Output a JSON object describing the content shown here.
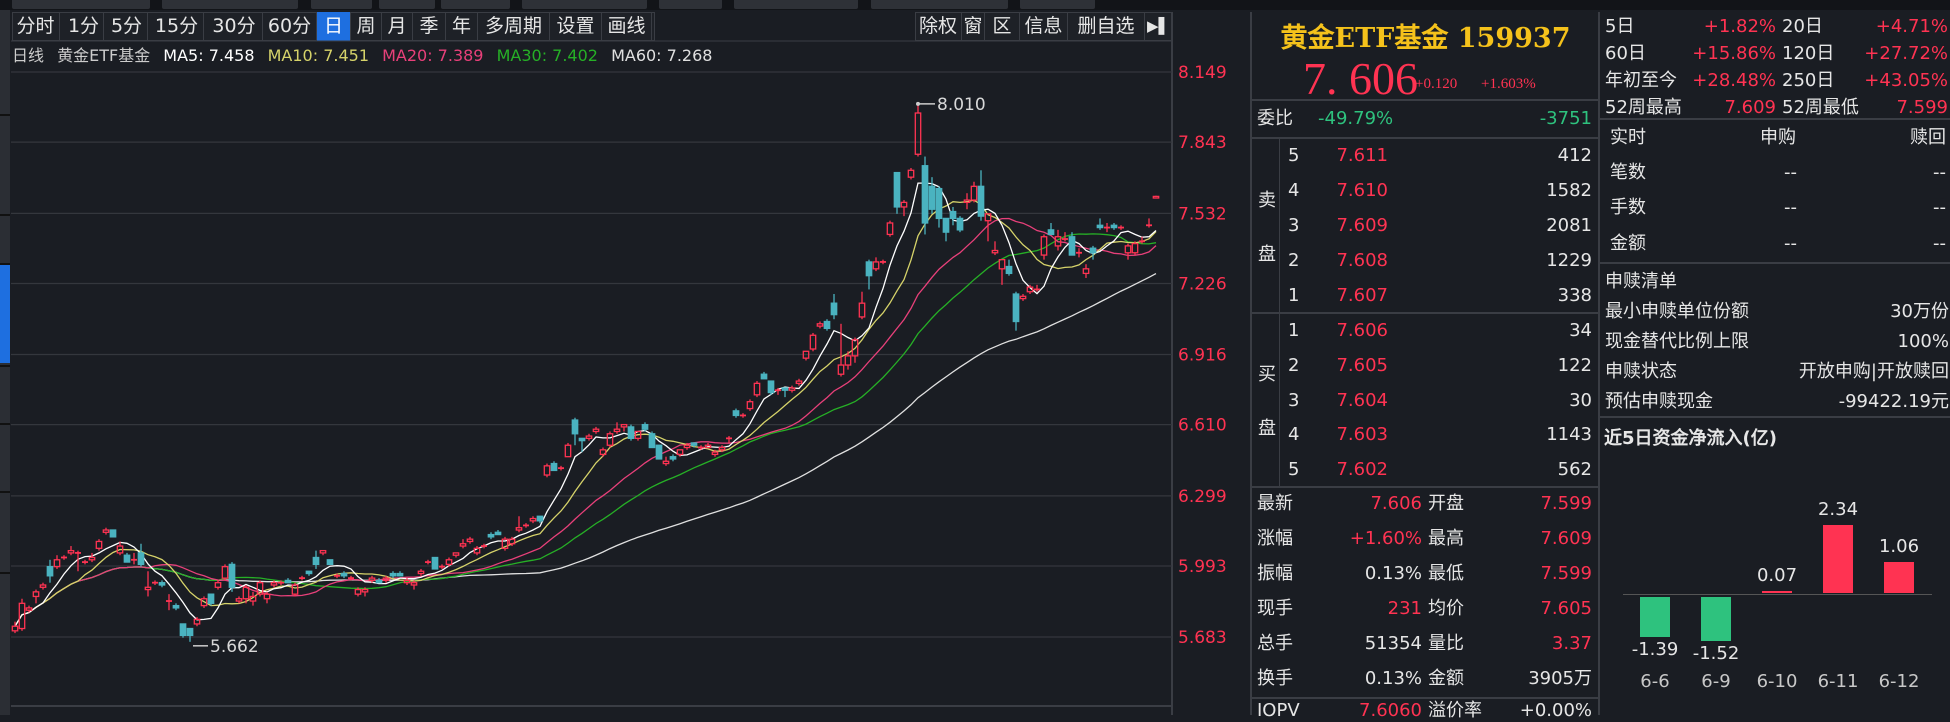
{
  "toolbar": {
    "tabs": [
      "分时",
      "1分",
      "5分",
      "15分",
      "30分",
      "60分",
      "日",
      "周",
      "月",
      "季",
      "年",
      "多周期",
      "设置",
      "画线"
    ],
    "active_tab": "日",
    "right_buttons": [
      "除权",
      "窗",
      "区",
      "信息",
      "删自选"
    ],
    "collapse_icon": "arrow-right-bar-icon"
  },
  "legend": {
    "period": "日线",
    "name": "黄金ETF基金",
    "ma5": "MA5: 7.458",
    "ma10": "MA10: 7.451",
    "ma20": "MA20: 7.389",
    "ma30": "MA30: 7.402",
    "ma60": "MA60: 7.268"
  },
  "colors": {
    "up": "#ff3352",
    "down": "#4ab3c0",
    "ma5": "#ffffff",
    "ma10": "#d6d36a",
    "ma20": "#e8407a",
    "ma30": "#26b026",
    "ma60": "#e0e0e0",
    "accent": "#1e6fe0",
    "title": "#f5c21b",
    "green": "#2ec27e"
  },
  "chart_data": {
    "type": "candlestick",
    "y_ticks": [
      "8.149",
      "7.843",
      "7.532",
      "7.226",
      "6.916",
      "6.610",
      "6.299",
      "5.993",
      "5.683"
    ],
    "ylim": [
      5.683,
      8.149
    ],
    "annotations": {
      "high": "8.010",
      "low": "5.662"
    },
    "ma_periods": [
      5,
      10,
      20,
      30,
      60
    ],
    "candles": [
      [
        5.71,
        5.75,
        5.7,
        5.73
      ],
      [
        5.72,
        5.85,
        5.71,
        5.83
      ],
      [
        5.8,
        5.82,
        5.79,
        5.81
      ],
      [
        5.86,
        5.89,
        5.83,
        5.88
      ],
      [
        5.9,
        5.92,
        5.89,
        5.91
      ],
      [
        5.99,
        6.02,
        5.92,
        5.95
      ],
      [
        5.99,
        6.04,
        5.98,
        6.02
      ],
      [
        6.03,
        6.04,
        6.02,
        6.03
      ],
      [
        6.05,
        6.08,
        6.04,
        6.06
      ],
      [
        6.05,
        6.06,
        5.97,
        6.05
      ],
      [
        6.01,
        6.02,
        6.0,
        6.01
      ],
      [
        6.02,
        6.05,
        6.01,
        6.03
      ],
      [
        6.07,
        6.11,
        6.06,
        6.1
      ],
      [
        6.14,
        6.16,
        6.13,
        6.15
      ],
      [
        6.15,
        6.15,
        6.12,
        6.12
      ],
      [
        6.05,
        6.1,
        6.04,
        6.08
      ],
      [
        6.04,
        6.05,
        6.01,
        6.01
      ],
      [
        6.02,
        6.05,
        6.0,
        6.02
      ],
      [
        6.05,
        6.09,
        5.99,
        6.0
      ],
      [
        5.89,
        5.97,
        5.86,
        5.9
      ],
      [
        5.92,
        5.93,
        5.91,
        5.92
      ],
      [
        5.92,
        5.93,
        5.9,
        5.91
      ],
      [
        5.84,
        5.87,
        5.8,
        5.84
      ],
      [
        5.82,
        5.83,
        5.8,
        5.81
      ],
      [
        5.74,
        5.74,
        5.68,
        5.69
      ],
      [
        5.72,
        5.72,
        5.662,
        5.69
      ],
      [
        5.74,
        5.77,
        5.73,
        5.76
      ],
      [
        5.82,
        5.86,
        5.81,
        5.85
      ],
      [
        5.87,
        5.87,
        5.82,
        5.83
      ],
      [
        5.9,
        5.93,
        5.89,
        5.92
      ],
      [
        5.94,
        6.0,
        5.93,
        5.99
      ],
      [
        6.0,
        6.01,
        5.88,
        5.9
      ],
      [
        5.84,
        5.86,
        5.83,
        5.85
      ],
      [
        5.85,
        5.91,
        5.83,
        5.9
      ],
      [
        5.84,
        5.88,
        5.82,
        5.86
      ],
      [
        5.87,
        5.93,
        5.86,
        5.92
      ],
      [
        5.85,
        5.88,
        5.83,
        5.87
      ],
      [
        5.91,
        5.93,
        5.9,
        5.92
      ],
      [
        5.92,
        5.93,
        5.91,
        5.92
      ],
      [
        5.93,
        5.94,
        5.92,
        5.92
      ],
      [
        5.87,
        5.92,
        5.86,
        5.91
      ],
      [
        5.94,
        5.95,
        5.93,
        5.94
      ],
      [
        5.97,
        5.97,
        5.95,
        5.96
      ],
      [
        6.03,
        6.06,
        5.98,
        6.0
      ],
      [
        6.05,
        6.06,
        6.04,
        6.06
      ],
      [
        6.02,
        6.02,
        6.0,
        6.0
      ],
      [
        5.95,
        5.96,
        5.94,
        5.95
      ],
      [
        5.96,
        5.97,
        5.94,
        5.95
      ],
      [
        5.94,
        5.95,
        5.93,
        5.94
      ],
      [
        5.87,
        5.9,
        5.86,
        5.89
      ],
      [
        5.88,
        5.9,
        5.86,
        5.89
      ],
      [
        5.93,
        5.95,
        5.92,
        5.94
      ],
      [
        5.93,
        5.94,
        5.92,
        5.92
      ],
      [
        5.93,
        5.95,
        5.92,
        5.94
      ],
      [
        5.96,
        5.97,
        5.94,
        5.95
      ],
      [
        5.96,
        5.97,
        5.95,
        5.95
      ],
      [
        5.92,
        5.94,
        5.91,
        5.93
      ],
      [
        5.91,
        5.93,
        5.89,
        5.92
      ],
      [
        5.96,
        5.98,
        5.95,
        5.97
      ],
      [
        6.01,
        6.02,
        6.0,
        6.01
      ],
      [
        6.03,
        6.03,
        5.98,
        5.98
      ],
      [
        5.99,
        6.0,
        5.98,
        5.99
      ],
      [
        6.0,
        6.03,
        5.99,
        6.02
      ],
      [
        6.04,
        6.05,
        6.03,
        6.05
      ],
      [
        6.08,
        6.11,
        6.07,
        6.09
      ],
      [
        6.1,
        6.12,
        6.09,
        6.11
      ],
      [
        6.05,
        6.08,
        6.04,
        6.07
      ],
      [
        6.08,
        6.09,
        6.07,
        6.08
      ],
      [
        6.13,
        6.14,
        6.11,
        6.12
      ],
      [
        6.14,
        6.15,
        6.13,
        6.13
      ],
      [
        6.07,
        6.12,
        6.06,
        6.11
      ],
      [
        6.09,
        6.12,
        6.08,
        6.11
      ],
      [
        6.15,
        6.21,
        6.14,
        6.16
      ],
      [
        6.17,
        6.18,
        6.16,
        6.17
      ],
      [
        6.19,
        6.21,
        6.18,
        6.2
      ],
      [
        6.21,
        6.21,
        6.18,
        6.19
      ],
      [
        6.39,
        6.44,
        6.38,
        6.43
      ],
      [
        6.44,
        6.45,
        6.41,
        6.41
      ],
      [
        6.42,
        6.43,
        6.41,
        6.42
      ],
      [
        6.47,
        6.53,
        6.47,
        6.52
      ],
      [
        6.63,
        6.64,
        6.52,
        6.57
      ],
      [
        6.55,
        6.55,
        6.49,
        6.54
      ],
      [
        6.55,
        6.57,
        6.54,
        6.56
      ],
      [
        6.58,
        6.6,
        6.57,
        6.59
      ],
      [
        6.48,
        6.51,
        6.47,
        6.5
      ],
      [
        6.52,
        6.58,
        6.51,
        6.57
      ],
      [
        6.58,
        6.62,
        6.57,
        6.59
      ],
      [
        6.6,
        6.61,
        6.58,
        6.61
      ],
      [
        6.6,
        6.61,
        6.54,
        6.55
      ],
      [
        6.55,
        6.58,
        6.54,
        6.58
      ],
      [
        6.61,
        6.62,
        6.58,
        6.59
      ],
      [
        6.57,
        6.58,
        6.51,
        6.51
      ],
      [
        6.52,
        6.52,
        6.46,
        6.46
      ],
      [
        6.44,
        6.47,
        6.43,
        6.45
      ],
      [
        6.47,
        6.48,
        6.45,
        6.46
      ],
      [
        6.48,
        6.5,
        6.47,
        6.5
      ],
      [
        6.51,
        6.53,
        6.5,
        6.52
      ],
      [
        6.53,
        6.53,
        6.51,
        6.52
      ],
      [
        6.51,
        6.52,
        6.5,
        6.51
      ],
      [
        6.51,
        6.53,
        6.51,
        6.52
      ],
      [
        6.48,
        6.5,
        6.47,
        6.49
      ],
      [
        6.5,
        6.52,
        6.49,
        6.51
      ],
      [
        6.55,
        6.56,
        6.53,
        6.55
      ],
      [
        6.67,
        6.68,
        6.64,
        6.65
      ],
      [
        6.65,
        6.66,
        6.64,
        6.65
      ],
      [
        6.68,
        6.72,
        6.67,
        6.71
      ],
      [
        6.74,
        6.8,
        6.73,
        6.79
      ],
      [
        6.83,
        6.84,
        6.81,
        6.81
      ],
      [
        6.8,
        6.8,
        6.74,
        6.75
      ],
      [
        6.76,
        6.77,
        6.74,
        6.76
      ],
      [
        6.77,
        6.77,
        6.73,
        6.76
      ],
      [
        6.76,
        6.78,
        6.75,
        6.77
      ],
      [
        6.79,
        6.81,
        6.78,
        6.8
      ],
      [
        6.9,
        6.93,
        6.89,
        6.93
      ],
      [
        6.94,
        7.01,
        6.93,
        7.0
      ],
      [
        7.04,
        7.06,
        7.03,
        7.05
      ],
      [
        7.06,
        7.07,
        7.02,
        7.03
      ],
      [
        7.14,
        7.18,
        7.07,
        7.09
      ],
      [
        6.83,
        7.05,
        6.82,
        6.87
      ],
      [
        6.87,
        6.93,
        6.85,
        6.91
      ],
      [
        6.91,
        6.99,
        6.88,
        6.98
      ],
      [
        7.08,
        7.19,
        7.07,
        7.14
      ],
      [
        7.32,
        7.33,
        7.2,
        7.26
      ],
      [
        7.29,
        7.34,
        7.28,
        7.32
      ],
      [
        7.32,
        7.33,
        7.31,
        7.32
      ],
      [
        7.44,
        7.5,
        7.43,
        7.49
      ],
      [
        7.71,
        7.71,
        7.53,
        7.56
      ],
      [
        7.56,
        7.59,
        7.52,
        7.58
      ],
      [
        7.69,
        7.73,
        7.68,
        7.72
      ],
      [
        7.79,
        8.01,
        7.78,
        7.97
      ],
      [
        7.74,
        7.78,
        7.44,
        7.49
      ],
      [
        7.65,
        7.69,
        7.53,
        7.55
      ],
      [
        7.64,
        7.65,
        7.47,
        7.51
      ],
      [
        7.51,
        7.51,
        7.41,
        7.45
      ],
      [
        7.54,
        7.56,
        7.48,
        7.51
      ],
      [
        7.51,
        7.52,
        7.45,
        7.46
      ],
      [
        7.58,
        7.62,
        7.55,
        7.59
      ],
      [
        7.59,
        7.67,
        7.58,
        7.65
      ],
      [
        7.65,
        7.72,
        7.5,
        7.52
      ],
      [
        7.5,
        7.53,
        7.41,
        7.53
      ],
      [
        7.36,
        7.41,
        7.35,
        7.37
      ],
      [
        7.29,
        7.33,
        7.22,
        7.33
      ],
      [
        7.3,
        7.33,
        7.26,
        7.27
      ],
      [
        7.18,
        7.19,
        7.02,
        7.06
      ],
      [
        7.16,
        7.18,
        7.15,
        7.17
      ],
      [
        7.19,
        7.22,
        7.18,
        7.21
      ],
      [
        7.2,
        7.22,
        7.19,
        7.2
      ],
      [
        7.35,
        7.44,
        7.33,
        7.43
      ],
      [
        7.46,
        7.49,
        7.44,
        7.44
      ],
      [
        7.39,
        7.46,
        7.37,
        7.43
      ],
      [
        7.42,
        7.45,
        7.41,
        7.42
      ],
      [
        7.43,
        7.45,
        7.35,
        7.35
      ],
      [
        7.36,
        7.38,
        7.34,
        7.36
      ],
      [
        7.27,
        7.31,
        7.25,
        7.29
      ],
      [
        7.38,
        7.39,
        7.33,
        7.36
      ],
      [
        7.48,
        7.51,
        7.46,
        7.47
      ],
      [
        7.47,
        7.49,
        7.45,
        7.47
      ],
      [
        7.48,
        7.49,
        7.46,
        7.47
      ],
      [
        7.47,
        7.48,
        7.46,
        7.47
      ],
      [
        7.36,
        7.4,
        7.33,
        7.39
      ],
      [
        7.36,
        7.41,
        7.35,
        7.4
      ],
      [
        7.41,
        7.43,
        7.4,
        7.41
      ],
      [
        7.48,
        7.51,
        7.47,
        7.48
      ],
      [
        7.599,
        7.609,
        7.599,
        7.606
      ]
    ]
  },
  "quote": {
    "title": "黄金ETF基金 159937",
    "price": "7. 606",
    "change": "+0.120",
    "change_pct": "+1.603%",
    "weibi": {
      "label": "委比",
      "pct": "-49.79%",
      "diff": "-3751"
    },
    "sell_label": [
      "卖",
      "盘"
    ],
    "buy_label": [
      "买",
      "盘"
    ],
    "sell": [
      [
        "5",
        "7.611",
        "412"
      ],
      [
        "4",
        "7.610",
        "1582"
      ],
      [
        "3",
        "7.609",
        "2081"
      ],
      [
        "2",
        "7.608",
        "1229"
      ],
      [
        "1",
        "7.607",
        "338"
      ]
    ],
    "buy": [
      [
        "1",
        "7.606",
        "34"
      ],
      [
        "2",
        "7.605",
        "122"
      ],
      [
        "3",
        "7.604",
        "30"
      ],
      [
        "4",
        "7.603",
        "1143"
      ],
      [
        "5",
        "7.602",
        "562"
      ]
    ],
    "stats": [
      [
        "最新",
        "7.606",
        "开盘",
        "7.599"
      ],
      [
        "涨幅",
        "+1.60%",
        "最高",
        "7.609"
      ],
      [
        "振幅",
        "0.13%",
        "最低",
        "7.599"
      ],
      [
        "现手",
        "231",
        "均价",
        "7.605"
      ],
      [
        "总手",
        "51354",
        "量比",
        "3.37"
      ],
      [
        "换手",
        "0.13%",
        "金额",
        "3905万"
      ],
      [
        "IOPV",
        "7.6060",
        "溢价率",
        "+0.00%"
      ]
    ]
  },
  "perf": [
    [
      "5日",
      "+1.82%",
      "20日",
      "+4.71%"
    ],
    [
      "60日",
      "+15.86%",
      "120日",
      "+27.72%"
    ],
    [
      "年初至今",
      "+28.48%",
      "250日",
      "+43.05%"
    ],
    [
      "52周最高",
      "7.609",
      "52周最低",
      "7.599"
    ]
  ],
  "realtime": {
    "headers": [
      "实时",
      "申购",
      "赎回"
    ],
    "rows": [
      [
        "笔数",
        "--",
        "--"
      ],
      [
        "手数",
        "--",
        "--"
      ],
      [
        "金额",
        "--",
        "--"
      ]
    ]
  },
  "creation": {
    "title": "申赎清单",
    "rows": [
      [
        "最小申赎单位份额",
        "30万份"
      ],
      [
        "现金替代比例上限",
        "100%"
      ],
      [
        "申赎状态",
        "开放申购|开放赎回"
      ],
      [
        "预估申赎现金",
        "-99422.19元"
      ]
    ]
  },
  "flow": {
    "title": "近5日资金净流入(亿)",
    "dates": [
      "6-6",
      "6-9",
      "6-10",
      "6-11",
      "6-12"
    ],
    "values": [
      -1.39,
      -1.52,
      0.07,
      2.34,
      1.06
    ],
    "labels": [
      "-1.39",
      "-1.52",
      "0.07",
      "2.34",
      "1.06"
    ]
  }
}
